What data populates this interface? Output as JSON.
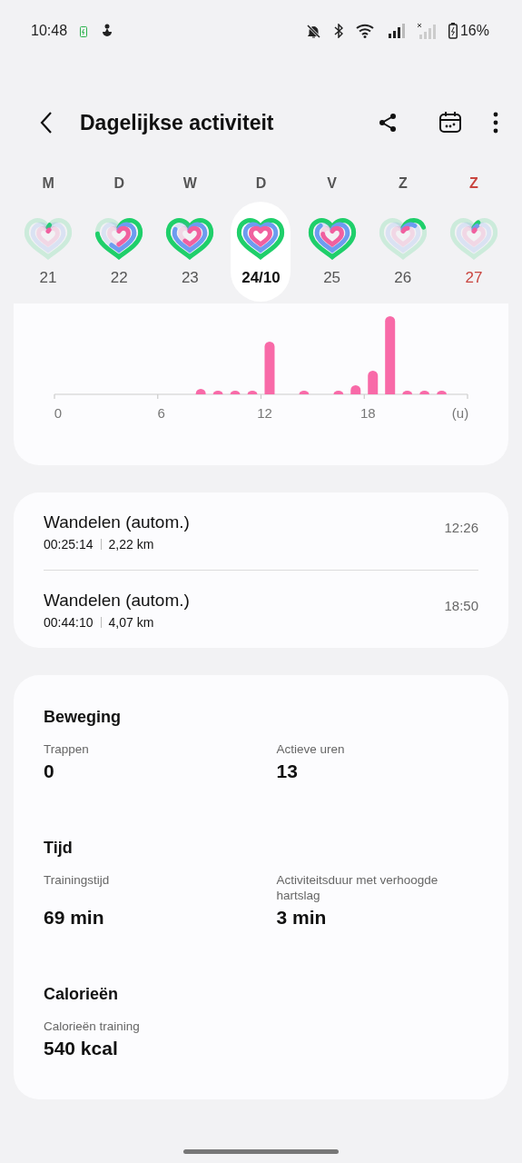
{
  "status_bar": {
    "time": "10:48",
    "battery": "16%"
  },
  "header": {
    "title": "Dagelijkse activiteit"
  },
  "days": [
    {
      "letter": "M",
      "date": "21",
      "selected": false,
      "color": "#555555"
    },
    {
      "letter": "D",
      "date": "22",
      "selected": false,
      "color": "#555555"
    },
    {
      "letter": "W",
      "date": "23",
      "selected": false,
      "color": "#555555"
    },
    {
      "letter": "D",
      "date": "24/10",
      "selected": true,
      "color": "#555555"
    },
    {
      "letter": "V",
      "date": "25",
      "selected": false,
      "color": "#555555"
    },
    {
      "letter": "Z",
      "date": "26",
      "selected": false,
      "color": "#555555"
    },
    {
      "letter": "Z",
      "date": "27",
      "selected": false,
      "color": "#c9453f"
    }
  ],
  "hourly_chart": {
    "x_labels": [
      "0",
      "6",
      "12",
      "18"
    ],
    "unit": "(u)"
  },
  "activities": [
    {
      "name": "Wandelen (autom.)",
      "duration": "00:25:14",
      "distance": "2,22 km",
      "time": "12:26"
    },
    {
      "name": "Wandelen (autom.)",
      "duration": "00:44:10",
      "distance": "4,07 km",
      "time": "18:50"
    }
  ],
  "sections": [
    {
      "title": "Beweging",
      "stats": [
        {
          "label": "Trappen",
          "value": "0"
        },
        {
          "label": "Actieve uren",
          "value": "13"
        }
      ]
    },
    {
      "title": "Tijd",
      "stats": [
        {
          "label": "Trainingstijd",
          "value": "69 min"
        },
        {
          "label": "Activiteitsduur met verhoogde hartslag",
          "value": "3 min"
        }
      ]
    },
    {
      "title": "Calorieën",
      "stats": [
        {
          "label": "Calorieën training",
          "value": "540 kcal"
        }
      ]
    }
  ]
}
